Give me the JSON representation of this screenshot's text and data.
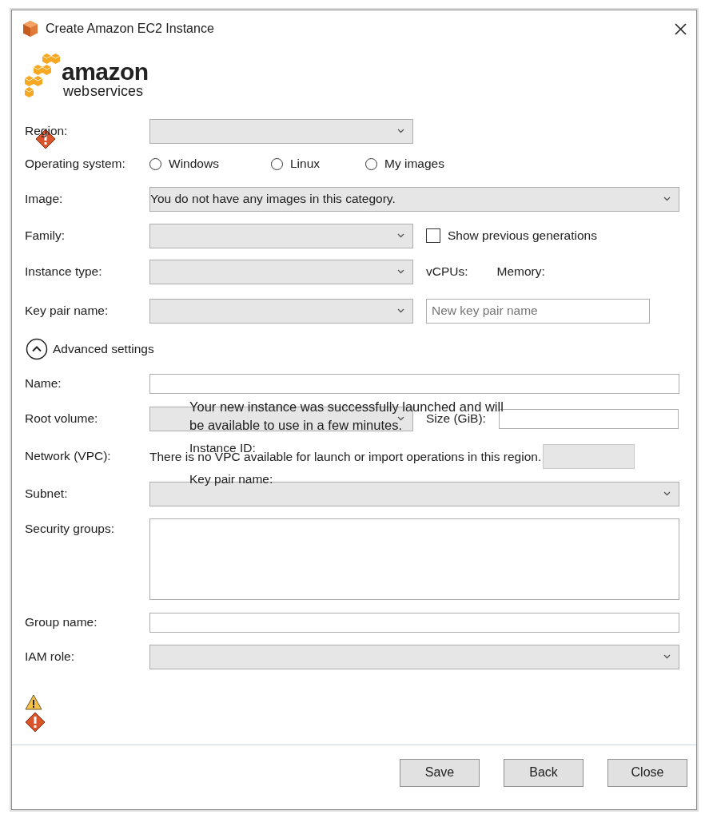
{
  "window": {
    "title": "Create Amazon EC2 Instance"
  },
  "logo": {
    "line_1": "amazon",
    "line_2": "web services"
  },
  "rows": [
    {
      "label": "Region:",
      "error": true,
      "control": {
        "kind": "dropdown"
      }
    },
    {
      "label": "Operating system:",
      "control": {
        "kind": "radios",
        "options": [
          {
            "label": "Windows",
            "selected": false
          },
          {
            "label": "Linux",
            "selected": false
          },
          {
            "label": "My images",
            "selected": false
          }
        ]
      }
    },
    {
      "label": "Image:",
      "control": {
        "kind": "wide-dropdown",
        "value": "You do not have any images in this category."
      }
    },
    {
      "label": "Family:",
      "control": {
        "kind": "dropdown"
      },
      "side": {
        "kind": "checkbox",
        "label": "Show previous generations",
        "checked": false
      }
    },
    {
      "label": "Instance type:",
      "control": {
        "kind": "dropdown"
      },
      "side": {
        "kind": "readouts",
        "texts": [
          "vCPUs:",
          "Memory:"
        ]
      }
    },
    {
      "label": "Key pair name:",
      "control": {
        "kind": "dropdown"
      },
      "side": {
        "kind": "input",
        "placeholder": "New key pair name"
      }
    },
    {
      "label": "Advanced settings",
      "control": {
        "kind": "toggle",
        "expanded": true
      }
    },
    {
      "label": "Name:",
      "control": {
        "kind": "text"
      }
    },
    {
      "label": "Root volume:",
      "control": {
        "kind": "dropdown"
      },
      "side": {
        "kind": "labelled-input",
        "label": "Size (GiB):"
      }
    },
    {
      "label": "Network (VPC):",
      "control": {
        "kind": "message",
        "text": "There is no VPC available for launch or import operations in this region."
      },
      "side": {
        "kind": "box"
      }
    },
    {
      "label": "Subnet:",
      "control": {
        "kind": "wide-dropdown"
      }
    },
    {
      "label": "Security groups:",
      "control": {
        "kind": "list"
      }
    },
    {
      "label": "Group name:",
      "control": {
        "kind": "text"
      }
    },
    {
      "label": "IAM role:",
      "control": {
        "kind": "wide-dropdown"
      }
    }
  ],
  "overlay": {
    "message_lines": [
      "Your new instance was successfully launched and will",
      "be available to use in a few minutes."
    ],
    "lines": [
      "Instance ID:",
      "Key pair name:"
    ]
  },
  "status_icons": [
    {
      "kind": "warning"
    },
    {
      "kind": "error"
    }
  ],
  "buttons": [
    "Save",
    "Back",
    "Close"
  ]
}
